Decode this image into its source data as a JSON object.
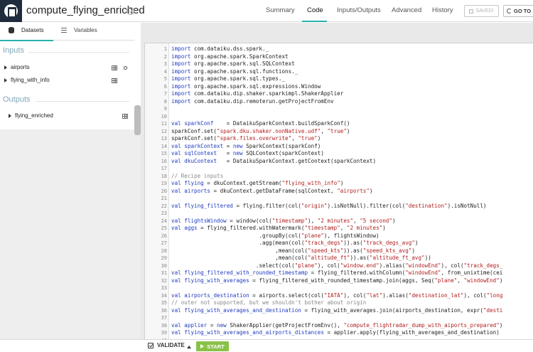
{
  "header": {
    "title": "compute_flying_enriched",
    "tabs": [
      "Summary",
      "Code",
      "Inputs/Outputs",
      "Advanced",
      "History"
    ],
    "active_tab": "Code",
    "saved_label": "SAVED!",
    "goto_label": "GO TO"
  },
  "left_panel": {
    "tabs": [
      "Datasets",
      "Variables"
    ],
    "inputs_label": "Inputs",
    "inputs": [
      "airports",
      "flying_with_info"
    ],
    "outputs_label": "Outputs",
    "outputs": [
      "flying_enriched"
    ]
  },
  "editor": {
    "lines": [
      {
        "n": "1",
        "parts": [
          [
            "kw",
            "import"
          ],
          [
            "t",
            " com.dataiku.dss.spark._"
          ]
        ]
      },
      {
        "n": "2",
        "parts": [
          [
            "kw",
            "import"
          ],
          [
            "t",
            " org.apache.spark.SparkContext"
          ]
        ]
      },
      {
        "n": "3",
        "parts": [
          [
            "kw",
            "import"
          ],
          [
            "t",
            " org.apache.spark.sql.SQLContext"
          ]
        ]
      },
      {
        "n": "4",
        "parts": [
          [
            "kw",
            "import"
          ],
          [
            "t",
            " org.apache.spark.sql.functions._"
          ]
        ]
      },
      {
        "n": "5",
        "parts": [
          [
            "kw",
            "import"
          ],
          [
            "t",
            " org.apache.spark.sql.types._"
          ]
        ]
      },
      {
        "n": "6",
        "parts": [
          [
            "kw",
            "import"
          ],
          [
            "t",
            " org.apache.spark.sql.expressions.Window"
          ]
        ]
      },
      {
        "n": "7",
        "parts": [
          [
            "kw",
            "import"
          ],
          [
            "t",
            " com.dataiku.dip.shaker.sparkimpl.ShakerApplier"
          ]
        ]
      },
      {
        "n": "8",
        "parts": [
          [
            "kw",
            "import"
          ],
          [
            "t",
            " com.dataiku.dip.remoterun.getProjectFromEnv"
          ]
        ]
      },
      {
        "n": "9",
        "parts": []
      },
      {
        "n": "10",
        "parts": []
      },
      {
        "n": "11",
        "parts": [
          [
            "kw",
            "val"
          ],
          [
            "t",
            " "
          ],
          [
            "vd",
            "sparkConf"
          ],
          [
            "t",
            "    = DataikuSparkContext.buildSparkConf()"
          ]
        ]
      },
      {
        "n": "12",
        "parts": [
          [
            "t",
            "sparkConf.set("
          ],
          [
            "str",
            "\"spark.dku.shaker.nonNative.udf\""
          ],
          [
            "t",
            ", "
          ],
          [
            "str",
            "\"true\""
          ],
          [
            "t",
            ")"
          ]
        ]
      },
      {
        "n": "13",
        "parts": [
          [
            "t",
            "sparkConf.set("
          ],
          [
            "str",
            "\"spark.files.overwrite\""
          ],
          [
            "t",
            ", "
          ],
          [
            "str",
            "\"true\""
          ],
          [
            "t",
            ")"
          ]
        ]
      },
      {
        "n": "14",
        "parts": [
          [
            "kw",
            "val"
          ],
          [
            "t",
            " "
          ],
          [
            "vd",
            "sparkContext"
          ],
          [
            "t",
            " = "
          ],
          [
            "kw",
            "new"
          ],
          [
            "t",
            " SparkContext(sparkConf)"
          ]
        ]
      },
      {
        "n": "15",
        "parts": [
          [
            "kw",
            "val"
          ],
          [
            "t",
            " "
          ],
          [
            "vd",
            "sqlContext"
          ],
          [
            "t",
            "   = "
          ],
          [
            "kw",
            "new"
          ],
          [
            "t",
            " SQLContext(sparkContext)"
          ]
        ]
      },
      {
        "n": "16",
        "parts": [
          [
            "kw",
            "val"
          ],
          [
            "t",
            " "
          ],
          [
            "vd",
            "dkuContext"
          ],
          [
            "t",
            "   = DataikuSparkContext.getContext(sparkContext)"
          ]
        ]
      },
      {
        "n": "17",
        "parts": []
      },
      {
        "n": "18",
        "parts": [
          [
            "cm",
            "// Recipe inputs"
          ]
        ]
      },
      {
        "n": "19",
        "parts": [
          [
            "kw",
            "val"
          ],
          [
            "t",
            " "
          ],
          [
            "vd",
            "flying"
          ],
          [
            "t",
            " = dkuContext.getStream("
          ],
          [
            "str",
            "\"flying_with_info\""
          ],
          [
            "t",
            ")"
          ]
        ]
      },
      {
        "n": "20",
        "parts": [
          [
            "kw",
            "val"
          ],
          [
            "t",
            " "
          ],
          [
            "vd",
            "airports"
          ],
          [
            "t",
            " = dkuContext.getDataFrame(sqlContext, "
          ],
          [
            "str",
            "\"airports\""
          ],
          [
            "t",
            ")"
          ]
        ]
      },
      {
        "n": "21",
        "parts": []
      },
      {
        "n": "22",
        "parts": [
          [
            "kw",
            "val"
          ],
          [
            "t",
            " "
          ],
          [
            "vd",
            "flying_filtered"
          ],
          [
            "t",
            " = flying.filter(col("
          ],
          [
            "str",
            "\"origin\""
          ],
          [
            "t",
            ").isNotNull).filter(col("
          ],
          [
            "str",
            "\"destination\""
          ],
          [
            "t",
            ").isNotNull)"
          ]
        ]
      },
      {
        "n": "23",
        "parts": []
      },
      {
        "n": "24",
        "parts": [
          [
            "kw",
            "val"
          ],
          [
            "t",
            " "
          ],
          [
            "vd",
            "flightsWindow"
          ],
          [
            "t",
            " = window(col("
          ],
          [
            "str",
            "\"timestamp\""
          ],
          [
            "t",
            "), "
          ],
          [
            "str",
            "\"2 minutes\""
          ],
          [
            "t",
            ", "
          ],
          [
            "str",
            "\"5 second\""
          ],
          [
            "t",
            ")"
          ]
        ]
      },
      {
        "n": "25",
        "parts": [
          [
            "kw",
            "val"
          ],
          [
            "t",
            " "
          ],
          [
            "vd",
            "aggs"
          ],
          [
            "t",
            " = flying_filtered.withWatermark("
          ],
          [
            "str",
            "\"timestamp\""
          ],
          [
            "t",
            ", "
          ],
          [
            "str",
            "\"2 minutes\""
          ],
          [
            "t",
            ")"
          ]
        ]
      },
      {
        "n": "26",
        "parts": [
          [
            "t",
            "                           .groupBy(col("
          ],
          [
            "str",
            "\"plane\""
          ],
          [
            "t",
            "), flightsWindow)"
          ]
        ]
      },
      {
        "n": "27",
        "parts": [
          [
            "t",
            "                           .agg(mean(col("
          ],
          [
            "str",
            "\"track_degs\""
          ],
          [
            "t",
            ")).as("
          ],
          [
            "str",
            "\"track_degs_avg\""
          ],
          [
            "t",
            ")"
          ]
        ]
      },
      {
        "n": "28",
        "parts": [
          [
            "t",
            "                                ,mean(col("
          ],
          [
            "str",
            "\"speed_kts\""
          ],
          [
            "t",
            ")).as("
          ],
          [
            "str",
            "\"speed_kts_avg\""
          ],
          [
            "t",
            ")"
          ]
        ]
      },
      {
        "n": "29",
        "parts": [
          [
            "t",
            "                                ,mean(col("
          ],
          [
            "str",
            "\"altitude_ft\""
          ],
          [
            "t",
            ")).as("
          ],
          [
            "str",
            "\"altitude_ft_avg\""
          ],
          [
            "t",
            "))"
          ]
        ]
      },
      {
        "n": "30",
        "parts": [
          [
            "t",
            "                          .select(col("
          ],
          [
            "str",
            "\"plane\""
          ],
          [
            "t",
            "), col("
          ],
          [
            "str",
            "\"window.end\""
          ],
          [
            "t",
            ").alias("
          ],
          [
            "str",
            "\"windowEnd\""
          ],
          [
            "t",
            "), col("
          ],
          [
            "str",
            "\"track_degs_"
          ]
        ]
      },
      {
        "n": "31",
        "parts": [
          [
            "kw",
            "val"
          ],
          [
            "t",
            " "
          ],
          [
            "vd",
            "flying_filtered_with_rounded_timestamp"
          ],
          [
            "t",
            " = flying_filtered.withColumn("
          ],
          [
            "str",
            "\"windowEnd\""
          ],
          [
            "t",
            ", from_unixtime(cei"
          ]
        ]
      },
      {
        "n": "32",
        "parts": [
          [
            "kw",
            "val"
          ],
          [
            "t",
            " "
          ],
          [
            "vd",
            "flying_with_averages"
          ],
          [
            "t",
            " = flying_filtered_with_rounded_timestamp.join(aggs, Seq("
          ],
          [
            "str",
            "\"plane\""
          ],
          [
            "t",
            ", "
          ],
          [
            "str",
            "\"windowEnd\""
          ],
          [
            "t",
            ")"
          ]
        ]
      },
      {
        "n": "33",
        "parts": []
      },
      {
        "n": "34",
        "parts": [
          [
            "kw",
            "val"
          ],
          [
            "t",
            " "
          ],
          [
            "vd",
            "airports_destination"
          ],
          [
            "t",
            " = airports.select(col("
          ],
          [
            "str",
            "\"IATA\""
          ],
          [
            "t",
            "), col("
          ],
          [
            "str",
            "\"lat\""
          ],
          [
            "t",
            ").alias("
          ],
          [
            "str",
            "\"destination_lat\""
          ],
          [
            "t",
            "), col("
          ],
          [
            "str",
            "\"long"
          ]
        ]
      },
      {
        "n": "35",
        "parts": [
          [
            "cm",
            "// outer not supported, but we shouldn't bother about origin"
          ]
        ]
      },
      {
        "n": "36",
        "parts": [
          [
            "kw",
            "val"
          ],
          [
            "t",
            " "
          ],
          [
            "vd",
            "flying_with_averages_and_destination"
          ],
          [
            "t",
            " = flying_with_averages.join(airports_destination, expr("
          ],
          [
            "str",
            "\"desti"
          ]
        ]
      },
      {
        "n": "37",
        "parts": []
      },
      {
        "n": "38",
        "parts": [
          [
            "kw",
            "val"
          ],
          [
            "t",
            " "
          ],
          [
            "vd",
            "applier"
          ],
          [
            "t",
            " = "
          ],
          [
            "kw",
            "new"
          ],
          [
            "t",
            " ShakerApplier(getProjectFromEnv(), "
          ],
          [
            "str",
            "\"compute_flightradar_dump_with_aiports_prepared\""
          ],
          [
            "t",
            ")"
          ]
        ]
      },
      {
        "n": "39",
        "parts": [
          [
            "kw",
            "val"
          ],
          [
            "t",
            " "
          ],
          [
            "vd",
            "flying_with_averages_and_airports_distances"
          ],
          [
            "t",
            " = applier.apply(flying_with_averages_and_destination)"
          ]
        ]
      },
      {
        "n": "40",
        "parts": []
      }
    ]
  },
  "footer": {
    "validate_label": "VALIDATE",
    "start_label": "START"
  },
  "colors": {
    "accent": "#2ab1ac",
    "start_green": "#8ac249",
    "section_label": "#7fa7b8",
    "logo_bg": "#1f2c3d"
  }
}
